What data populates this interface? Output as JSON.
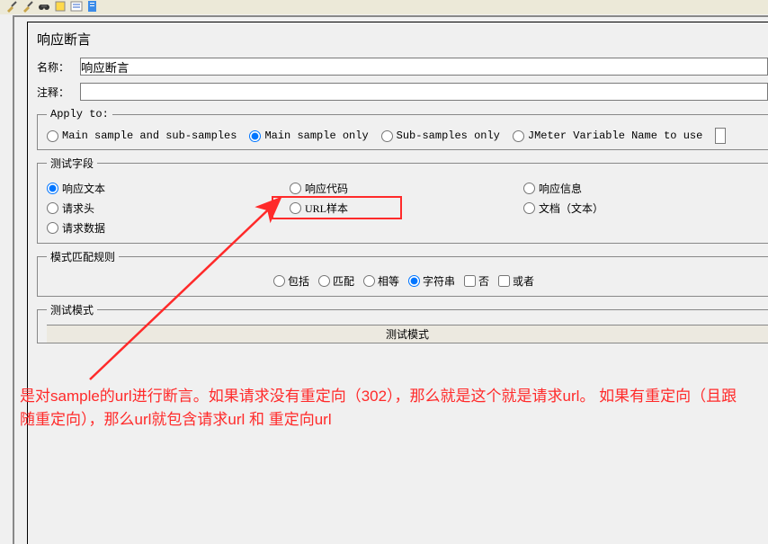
{
  "title": "响应断言",
  "labels": {
    "name": "名称：",
    "comment": "注释："
  },
  "values": {
    "name": "响应断言",
    "comment": ""
  },
  "apply_to": {
    "legend": "Apply to:",
    "options": {
      "main_sub": "Main sample and sub-samples",
      "main_only": "Main sample only",
      "sub_only": "Sub-samples only",
      "jmeter_var": "JMeter Variable Name to use"
    }
  },
  "test_field": {
    "legend": "测试字段",
    "options": {
      "resp_text": "响应文本",
      "resp_code": "响应代码",
      "resp_info": "响应信息",
      "req_head": "请求头",
      "url_sample": "URL样本",
      "doc_text": "文档（文本）",
      "req_data": "请求数据"
    }
  },
  "pattern_rules": {
    "legend": "模式匹配规则",
    "options": {
      "contains": "包括",
      "matches": "匹配",
      "equals": "相等",
      "substring": "字符串",
      "not": "否",
      "or": "或者"
    }
  },
  "test_mode": {
    "legend": "测试模式",
    "header": "测试模式"
  },
  "annotation": "是对sample的url进行断言。如果请求没有重定向（302），那么就是这个就是请求url。 如果有重定向（且跟随重定向），那么url就包含请求url 和 重定向url"
}
